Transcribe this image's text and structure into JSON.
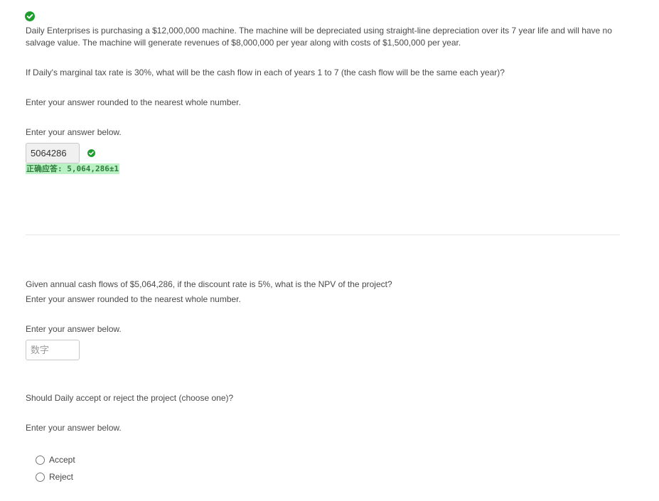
{
  "question1": {
    "paragraph1": "Daily Enterprises is purchasing a $12,000,000 machine. The machine will be depreciated using straight-line depreciation over its 7 year life and will have no salvage value. The machine will generate revenues of $8,000,000 per year along with costs of $1,500,000 per year.",
    "paragraph2": "If Daily's marginal tax rate is 30%, what will be the cash flow in each of years 1 to 7 (the cash flow will be the same each year)?",
    "paragraph3": "Enter your answer rounded to the nearest whole number.",
    "prompt": "Enter your answer below.",
    "answer_value": "5064286",
    "correct_answer_text": "正确应答: 5,064,286±1"
  },
  "question2": {
    "paragraph1": "Given annual cash flows of $5,064,286, if the discount rate is 5%, what is the NPV of the project?",
    "paragraph2": "Enter your answer rounded to the nearest whole number.",
    "prompt": "Enter your answer below.",
    "input_placeholder": "数字"
  },
  "question3": {
    "paragraph1": "Should Daily accept or reject the project (choose one)?",
    "prompt": "Enter your answer below.",
    "options": [
      {
        "label": "Accept"
      },
      {
        "label": "Reject"
      }
    ]
  },
  "colors": {
    "correct_green": "#1f9d2f",
    "correct_answer_bg": "#b9f0c4"
  },
  "icons": {
    "question_status": "check-circle-icon",
    "answer_status": "check-circle-icon"
  }
}
